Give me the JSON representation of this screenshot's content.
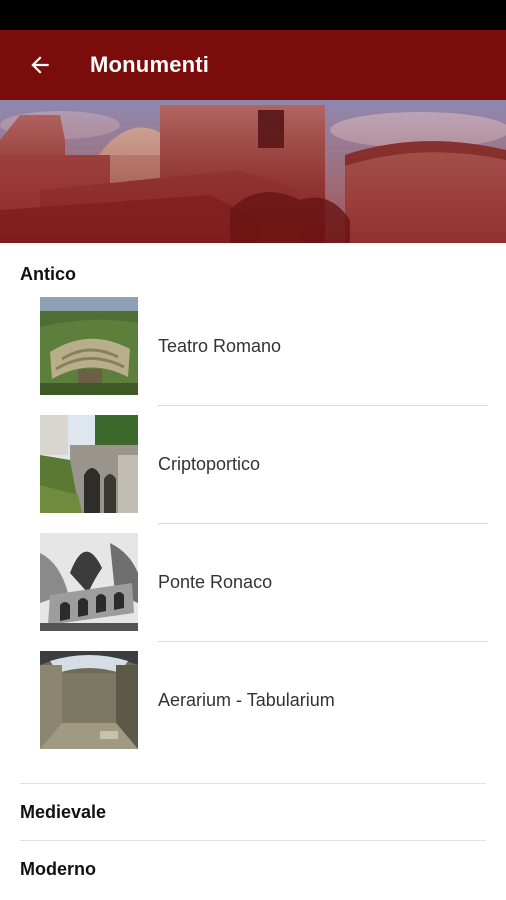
{
  "app_bar": {
    "title": "Monumenti",
    "back_icon": "arrow-back-icon",
    "color": "#7a0c0c"
  },
  "sections": {
    "antico": {
      "label": "Antico",
      "items": [
        {
          "label": "Teatro Romano",
          "icon": "teatro-romano-thumbnail"
        },
        {
          "label": "Criptoportico",
          "icon": "criptoportico-thumbnail"
        },
        {
          "label": "Ponte Ronaco",
          "icon": "ponte-ronaco-thumbnail"
        },
        {
          "label": "Aerarium - Tabularium",
          "icon": "aerarium-tabularium-thumbnail"
        }
      ]
    },
    "medievale": {
      "label": "Medievale"
    },
    "moderno": {
      "label": "Moderno"
    }
  }
}
